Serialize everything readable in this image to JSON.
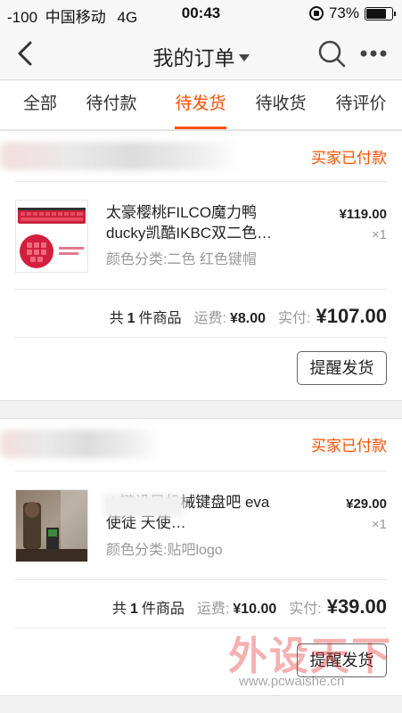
{
  "status_bar": {
    "signal": "-100",
    "carrier": "中国移动",
    "network": "4G",
    "time": "00:43",
    "battery": "73%"
  },
  "nav": {
    "title": "我的订单",
    "icons": {
      "back": "back-chevron-icon",
      "search": "search-icon",
      "more": "more-dots-icon",
      "caret": "caret-down-icon"
    }
  },
  "tabs": [
    {
      "label": "全部"
    },
    {
      "label": "待付款"
    },
    {
      "label": "待发货",
      "active": true
    },
    {
      "label": "待收货"
    },
    {
      "label": "待评价"
    }
  ],
  "orders": [
    {
      "status": "买家已付款",
      "item": {
        "title": "太豪樱桃FILCO魔力鸭ducky凯酷IKBC双二色…",
        "sku": "颜色分类:二色 红色键帽",
        "price": "¥119.00",
        "qty": "×1"
      },
      "summary": {
        "count_prefix": "共",
        "count": "1",
        "count_suffix": "件商品",
        "shipping_label": "运费:",
        "shipping": "¥8.00",
        "paid_label": "实付:",
        "total": "¥107.00"
      },
      "action": "提醒发货"
    },
    {
      "status": "买家已付款",
      "item": {
        "title": "☆键设局机械键盘吧 eva 使徒 天使…",
        "sku": "颜色分类:贴吧logo",
        "price": "¥29.00",
        "qty": "×1"
      },
      "summary": {
        "count_prefix": "共",
        "count": "1",
        "count_suffix": "件商品",
        "shipping_label": "运费:",
        "shipping": "¥10.00",
        "paid_label": "实付:",
        "total": "¥39.00"
      },
      "action": "提醒发货"
    }
  ],
  "watermark": {
    "text": "外设天下",
    "url": "www.pcwaishe.cn"
  },
  "colors": {
    "accent": "#ff5000",
    "background": "#f2f2f2",
    "card": "#ffffff"
  }
}
